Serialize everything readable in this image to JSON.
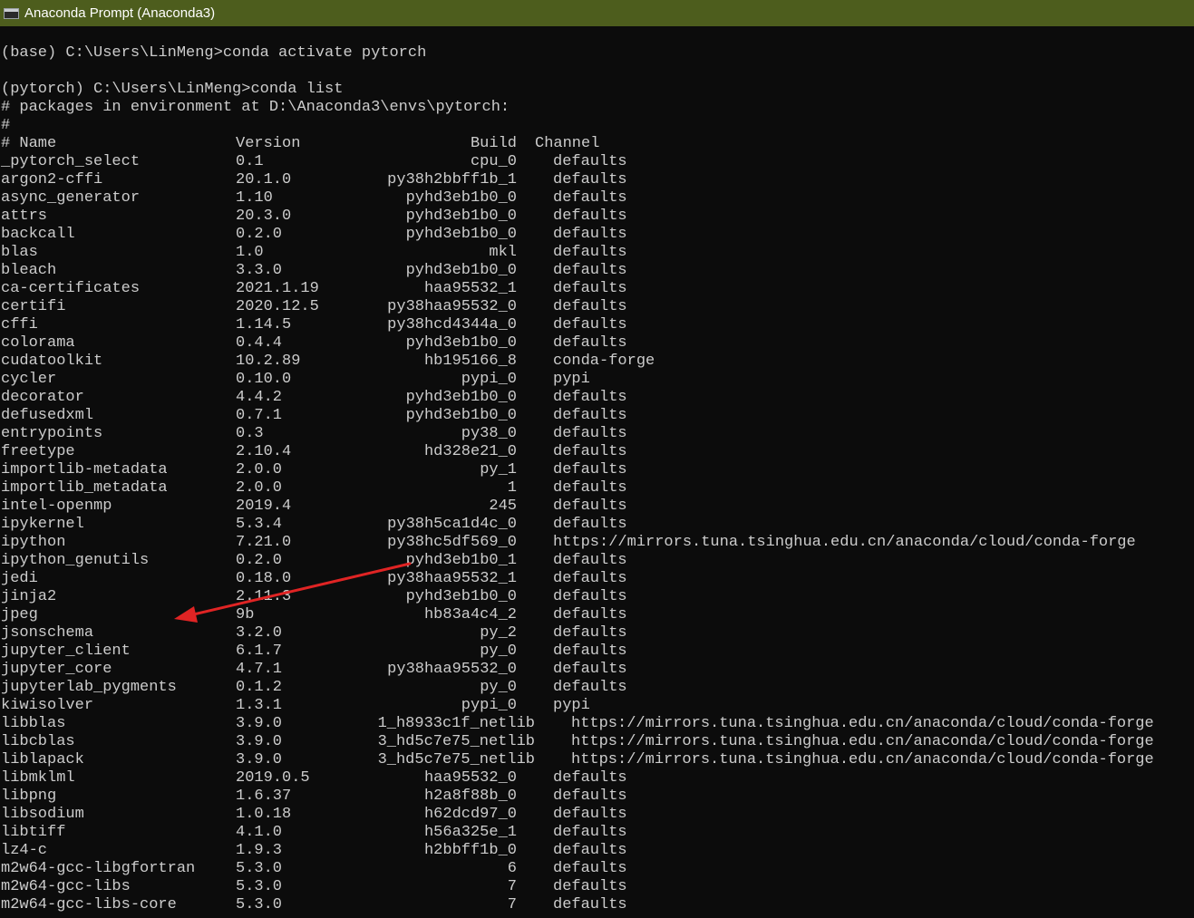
{
  "window": {
    "title": "Anaconda Prompt (Anaconda3)",
    "icon": "cmd-icon"
  },
  "prompt_lines": [
    "(base) C:\\Users\\LinMeng>conda activate pytorch",
    "(pytorch) C:\\Users\\LinMeng>conda list",
    "# packages in environment at D:\\Anaconda3\\envs\\pytorch:",
    "#"
  ],
  "table_header": {
    "name": "# Name",
    "version": "Version",
    "build": "Build",
    "channel": "Channel"
  },
  "packages": [
    {
      "name": "_pytorch_select",
      "version": "0.1",
      "build": "cpu_0",
      "channel": "defaults"
    },
    {
      "name": "argon2-cffi",
      "version": "20.1.0",
      "build": "py38h2bbff1b_1",
      "channel": "defaults"
    },
    {
      "name": "async_generator",
      "version": "1.10",
      "build": "pyhd3eb1b0_0",
      "channel": "defaults"
    },
    {
      "name": "attrs",
      "version": "20.3.0",
      "build": "pyhd3eb1b0_0",
      "channel": "defaults"
    },
    {
      "name": "backcall",
      "version": "0.2.0",
      "build": "pyhd3eb1b0_0",
      "channel": "defaults"
    },
    {
      "name": "blas",
      "version": "1.0",
      "build": "mkl",
      "channel": "defaults"
    },
    {
      "name": "bleach",
      "version": "3.3.0",
      "build": "pyhd3eb1b0_0",
      "channel": "defaults"
    },
    {
      "name": "ca-certificates",
      "version": "2021.1.19",
      "build": "haa95532_1",
      "channel": "defaults"
    },
    {
      "name": "certifi",
      "version": "2020.12.5",
      "build": "py38haa95532_0",
      "channel": "defaults"
    },
    {
      "name": "cffi",
      "version": "1.14.5",
      "build": "py38hcd4344a_0",
      "channel": "defaults"
    },
    {
      "name": "colorama",
      "version": "0.4.4",
      "build": "pyhd3eb1b0_0",
      "channel": "defaults"
    },
    {
      "name": "cudatoolkit",
      "version": "10.2.89",
      "build": "hb195166_8",
      "channel": "conda-forge"
    },
    {
      "name": "cycler",
      "version": "0.10.0",
      "build": "pypi_0",
      "channel": "pypi"
    },
    {
      "name": "decorator",
      "version": "4.4.2",
      "build": "pyhd3eb1b0_0",
      "channel": "defaults"
    },
    {
      "name": "defusedxml",
      "version": "0.7.1",
      "build": "pyhd3eb1b0_0",
      "channel": "defaults"
    },
    {
      "name": "entrypoints",
      "version": "0.3",
      "build": "py38_0",
      "channel": "defaults"
    },
    {
      "name": "freetype",
      "version": "2.10.4",
      "build": "hd328e21_0",
      "channel": "defaults"
    },
    {
      "name": "importlib-metadata",
      "version": "2.0.0",
      "build": "py_1",
      "channel": "defaults"
    },
    {
      "name": "importlib_metadata",
      "version": "2.0.0",
      "build": "1",
      "channel": "defaults"
    },
    {
      "name": "intel-openmp",
      "version": "2019.4",
      "build": "245",
      "channel": "defaults"
    },
    {
      "name": "ipykernel",
      "version": "5.3.4",
      "build": "py38h5ca1d4c_0",
      "channel": "defaults"
    },
    {
      "name": "ipython",
      "version": "7.21.0",
      "build": "py38hc5df569_0",
      "channel": "https://mirrors.tuna.tsinghua.edu.cn/anaconda/cloud/conda-forge"
    },
    {
      "name": "ipython_genutils",
      "version": "0.2.0",
      "build": "pyhd3eb1b0_1",
      "channel": "defaults"
    },
    {
      "name": "jedi",
      "version": "0.18.0",
      "build": "py38haa95532_1",
      "channel": "defaults"
    },
    {
      "name": "jinja2",
      "version": "2.11.3",
      "build": "pyhd3eb1b0_0",
      "channel": "defaults"
    },
    {
      "name": "jpeg",
      "version": "9b",
      "build": "hb83a4c4_2",
      "channel": "defaults"
    },
    {
      "name": "jsonschema",
      "version": "3.2.0",
      "build": "py_2",
      "channel": "defaults"
    },
    {
      "name": "jupyter_client",
      "version": "6.1.7",
      "build": "py_0",
      "channel": "defaults"
    },
    {
      "name": "jupyter_core",
      "version": "4.7.1",
      "build": "py38haa95532_0",
      "channel": "defaults"
    },
    {
      "name": "jupyterlab_pygments",
      "version": "0.1.2",
      "build": "py_0",
      "channel": "defaults"
    },
    {
      "name": "kiwisolver",
      "version": "1.3.1",
      "build": "pypi_0",
      "channel": "pypi"
    },
    {
      "name": "libblas",
      "version": "3.9.0",
      "build": "1_h8933c1f_netlib",
      "channel": "https://mirrors.tuna.tsinghua.edu.cn/anaconda/cloud/conda-forge"
    },
    {
      "name": "libcblas",
      "version": "3.9.0",
      "build": "3_hd5c7e75_netlib",
      "channel": "https://mirrors.tuna.tsinghua.edu.cn/anaconda/cloud/conda-forge"
    },
    {
      "name": "liblapack",
      "version": "3.9.0",
      "build": "3_hd5c7e75_netlib",
      "channel": "https://mirrors.tuna.tsinghua.edu.cn/anaconda/cloud/conda-forge"
    },
    {
      "name": "libmklml",
      "version": "2019.0.5",
      "build": "haa95532_0",
      "channel": "defaults"
    },
    {
      "name": "libpng",
      "version": "1.6.37",
      "build": "h2a8f88b_0",
      "channel": "defaults"
    },
    {
      "name": "libsodium",
      "version": "1.0.18",
      "build": "h62dcd97_0",
      "channel": "defaults"
    },
    {
      "name": "libtiff",
      "version": "4.1.0",
      "build": "h56a325e_1",
      "channel": "defaults"
    },
    {
      "name": "lz4-c",
      "version": "1.9.3",
      "build": "h2bbff1b_0",
      "channel": "defaults"
    },
    {
      "name": "m2w64-gcc-libgfortran",
      "version": "5.3.0",
      "build": "6",
      "channel": "defaults"
    },
    {
      "name": "m2w64-gcc-libs",
      "version": "5.3.0",
      "build": "7",
      "channel": "defaults"
    },
    {
      "name": "m2w64-gcc-libs-core",
      "version": "5.3.0",
      "build": "7",
      "channel": "defaults"
    }
  ],
  "annotation": {
    "color": "#e02424",
    "points_to_package": "jpeg"
  },
  "colors": {
    "titlebar": "#4d5d1d",
    "background": "#0c0c0c",
    "text": "#cccccc"
  }
}
